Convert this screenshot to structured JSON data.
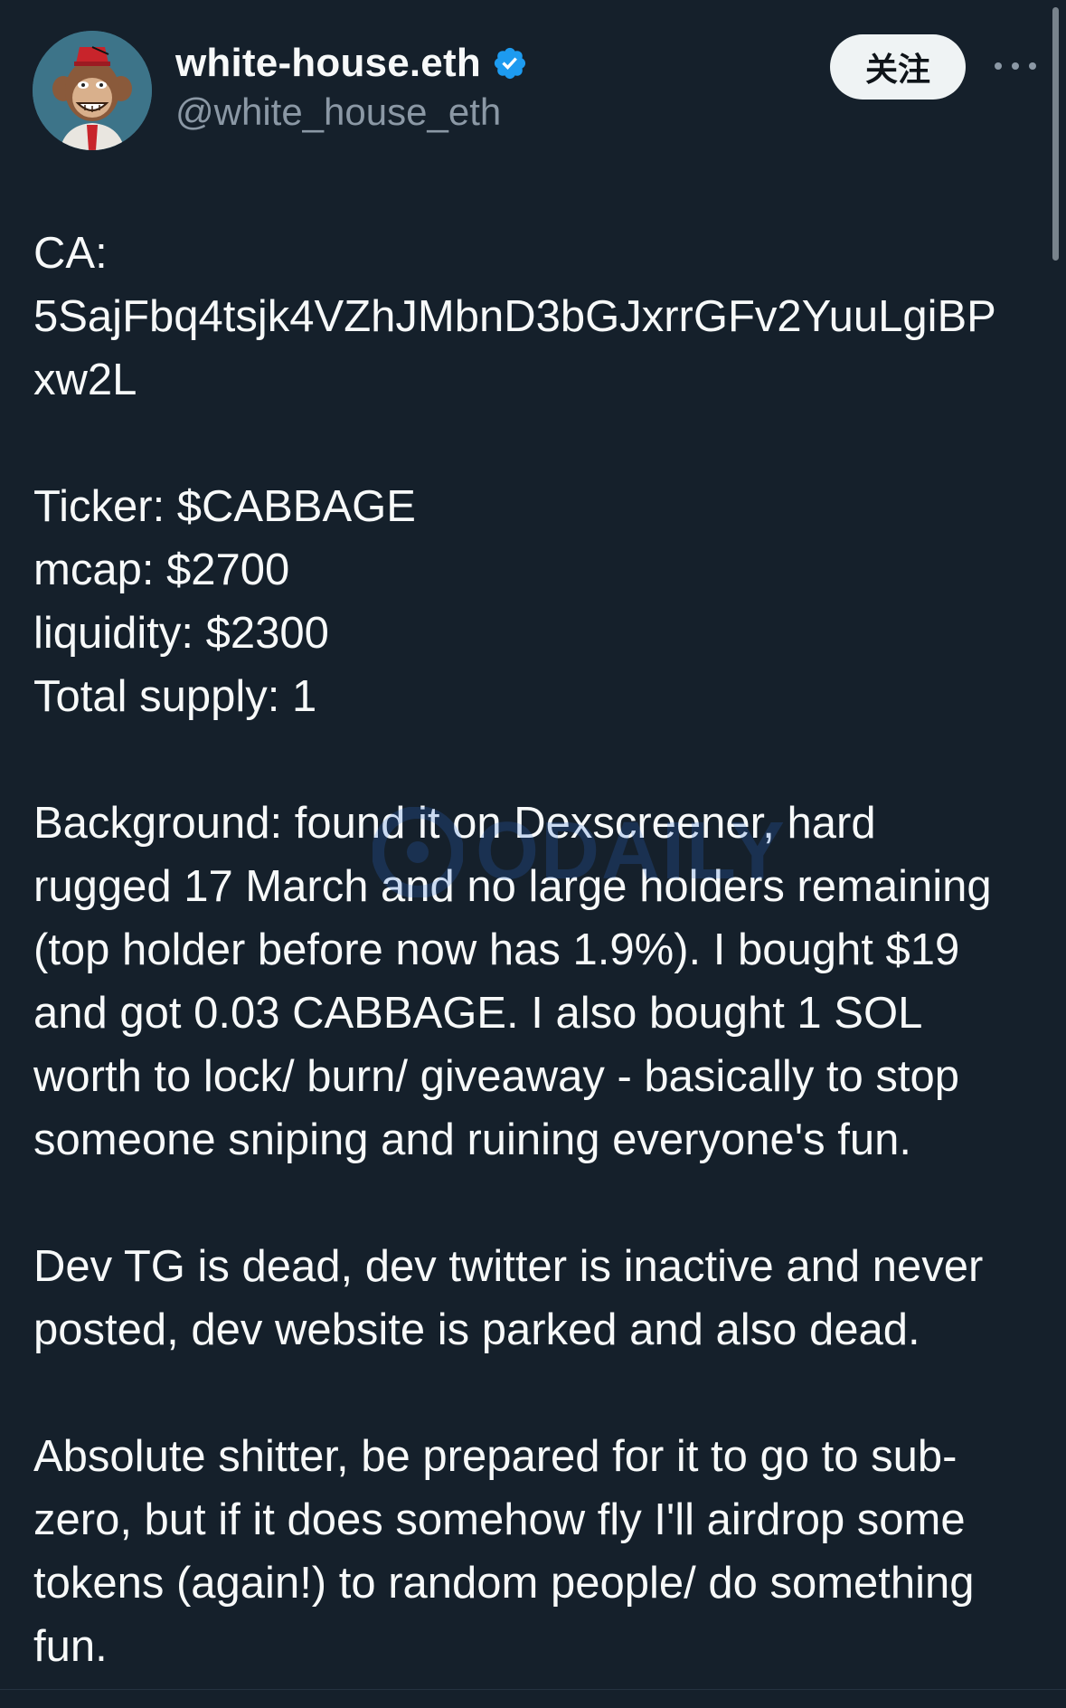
{
  "author": {
    "display_name": "white-house.eth",
    "handle": "@white_house_eth",
    "verified": true,
    "avatar_icon": "bored-ape-avatar-icon"
  },
  "actions": {
    "follow_label": "关注",
    "more_icon": "more-options-icon"
  },
  "tweet": {
    "paragraphs": [
      [
        "CA:",
        "5SajFbq4tsjk4VZhJMbnD3bGJxrrGFv2YuuLgiBP",
        "xw2L"
      ],
      [
        "Ticker: $CABBAGE",
        "mcap: $2700",
        "liquidity: $2300",
        "Total supply: 1"
      ],
      [
        "Background: found it on Dexscreener, hard",
        "rugged 17 March and no large holders remaining",
        "(top holder before now has 1.9%). I bought $19",
        "and got 0.03 CABBAGE. I also bought 1 SOL",
        "worth to lock/ burn/ giveaway - basically to stop",
        "someone sniping and ruining everyone's fun."
      ],
      [
        "Dev TG is dead, dev twitter is inactive and never",
        "posted, dev website is parked and also dead."
      ],
      [
        "Absolute shitter, be prepared for it to go to sub-",
        "zero, but if it does somehow fly I'll airdrop some",
        "tokens (again!) to random people/ do something",
        "fun."
      ]
    ]
  },
  "watermark": {
    "text": "ODAILY"
  },
  "colors": {
    "background": "#15202b",
    "text_primary": "#f7f9f9",
    "text_secondary": "#8b98a5",
    "verified_blue": "#1d9bf0",
    "follow_bg": "#eff3f4"
  }
}
